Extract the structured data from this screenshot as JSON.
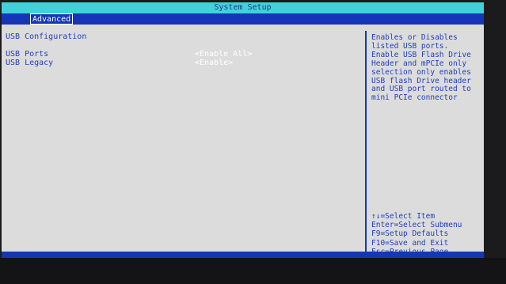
{
  "window": {
    "title": "System Setup"
  },
  "tabs": [
    {
      "label": "Advanced"
    }
  ],
  "section": {
    "heading": "USB Configuration"
  },
  "settings": [
    {
      "label": "USB Ports",
      "value": "<Enable All>"
    },
    {
      "label": "USB Legacy",
      "value": "<Enable>"
    }
  ],
  "help": {
    "lines": [
      "Enables or Disables",
      "listed USB ports.",
      "Enable USB Flash Drive",
      "Header and mPCIe only",
      "selection only enables",
      "USB flash Drive header",
      "and USB port routed to",
      "mini PCIe connector"
    ]
  },
  "keys": [
    "↑↓=Select Item",
    "Enter=Select Submenu",
    "F9=Setup Defaults",
    "F10=Save and Exit",
    "Esc=Previous Page"
  ],
  "colors": {
    "title_bar": "#3fd2d8",
    "tab_bar": "#1437b8",
    "text": "#1f3fb8",
    "value": "#ffffff",
    "background": "#dcdcdc"
  }
}
